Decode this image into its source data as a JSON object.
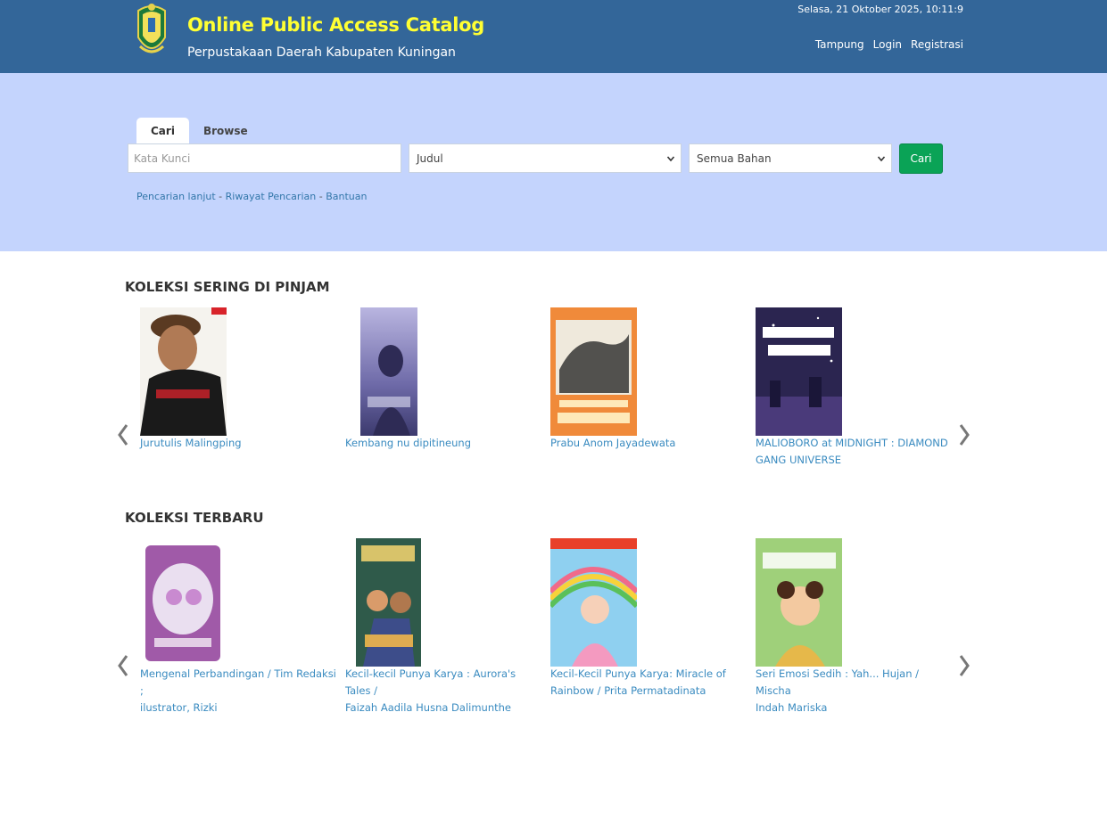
{
  "header": {
    "title": "Online Public Access Catalog",
    "subtitle": "Perpustakaan Daerah Kabupaten Kuningan",
    "datetime": "Selasa, 21 Oktober 2025, 10:11:9",
    "nav": [
      "Tampung",
      "Login",
      "Registrasi"
    ]
  },
  "search": {
    "tabs": [
      "Cari",
      "Browse"
    ],
    "keyword_placeholder": "Kata Kunci",
    "field_selected": "Judul",
    "material_selected": "Semua Bahan",
    "button_label": "Cari",
    "links": [
      "Pencarian lanjut",
      "Riwayat Pencarian",
      "Bantuan"
    ],
    "separator": "-"
  },
  "sections": [
    {
      "title": "KOLEKSI SERING DI PINJAM",
      "items": [
        {
          "line1": "Jurutulis Malingping",
          "line2": ""
        },
        {
          "line1": "Kembang nu dipitineung",
          "line2": ""
        },
        {
          "line1": "Prabu Anom Jayadewata",
          "line2": ""
        },
        {
          "line1": "MALIOBORO at MIDNIGHT : DIAMOND",
          "line2": "GANG UNIVERSE"
        }
      ]
    },
    {
      "title": "KOLEKSI TERBARU",
      "items": [
        {
          "line1": "Mengenal Perbandingan / Tim Redaksi ;",
          "line2": "ilustrator, Rizki"
        },
        {
          "line1": "Kecil-kecil Punya Karya : Aurora's Tales /",
          "line2": "Faizah Aadila Husna Dalimunthe"
        },
        {
          "line1": "Kecil-Kecil Punya Karya: Miracle of",
          "line2": "Rainbow / Prita Permatadinata"
        },
        {
          "line1": "Seri Emosi Sedih : Yah... Hujan / Mischa",
          "line2": "Indah Mariska"
        }
      ]
    }
  ],
  "colors": {
    "header_bg": "#336699",
    "title": "#ffff33",
    "search_band": "#c4d4fd",
    "button": "#0aa356",
    "link": "#3a8bc0"
  }
}
